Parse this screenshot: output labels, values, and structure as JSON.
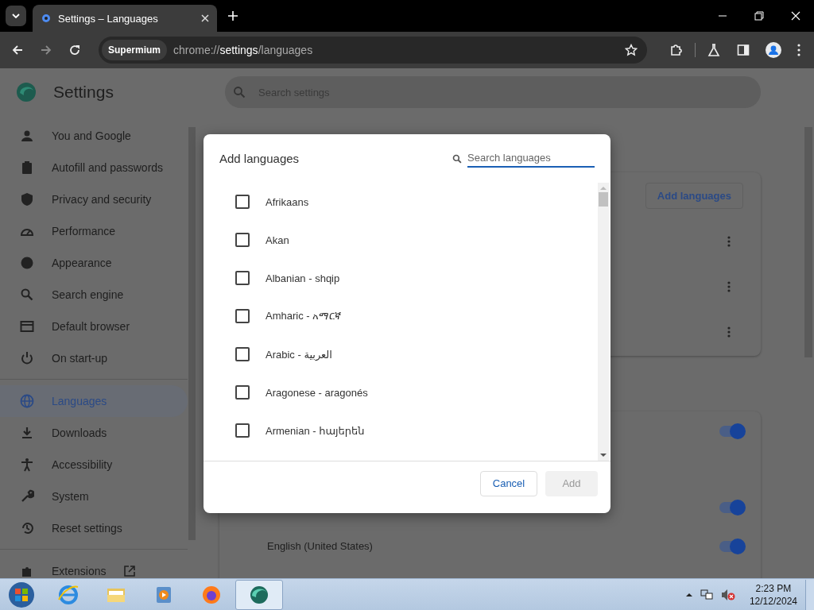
{
  "browser": {
    "tab_title": "Settings – Languages",
    "site_chip": "Supermium",
    "url": "chrome://**settings**/languages"
  },
  "settings": {
    "title": "Settings",
    "search": {
      "placeholder": "Search settings"
    },
    "nav": [
      {
        "label": "You and Google",
        "selected": false
      },
      {
        "label": "Autofill and passwords",
        "selected": false
      },
      {
        "label": "Privacy and security",
        "selected": false
      },
      {
        "label": "Performance",
        "selected": false
      },
      {
        "label": "Appearance",
        "selected": false
      },
      {
        "label": "Search engine",
        "selected": false
      },
      {
        "label": "Default browser",
        "selected": false
      },
      {
        "label": "On start-up",
        "selected": false
      },
      {
        "label": "Languages",
        "selected": true
      },
      {
        "label": "Downloads",
        "selected": false
      },
      {
        "label": "Accessibility",
        "selected": false
      },
      {
        "label": "System",
        "selected": false
      },
      {
        "label": "Reset settings",
        "selected": false
      },
      {
        "label": "Extensions",
        "selected": false
      }
    ],
    "add_languages_button": "Add languages",
    "toggle_rows": [
      {
        "on": true
      },
      {
        "on": true
      },
      {
        "label": "English (United States)",
        "on": true
      }
    ]
  },
  "dialog": {
    "title": "Add languages",
    "search": {
      "placeholder": "Search languages"
    },
    "languages": [
      {
        "label": "Afrikaans",
        "checked": false
      },
      {
        "label": "Akan",
        "checked": false
      },
      {
        "label": "Albanian - shqip",
        "checked": false
      },
      {
        "label": "Amharic - አማርኛ",
        "checked": false
      },
      {
        "label": "Arabic - العربية",
        "checked": false
      },
      {
        "label": "Aragonese - aragonés",
        "checked": false
      },
      {
        "label": "Armenian - հայերեն",
        "checked": false
      }
    ],
    "cancel": "Cancel",
    "add": {
      "label": "Add",
      "disabled": true
    }
  },
  "taskbar": {
    "apps": [
      {
        "selected": false
      },
      {
        "selected": false
      },
      {
        "selected": false
      },
      {
        "selected": false
      },
      {
        "selected": true
      }
    ],
    "time": "2:23 PM",
    "date": "12/12/2024"
  }
}
